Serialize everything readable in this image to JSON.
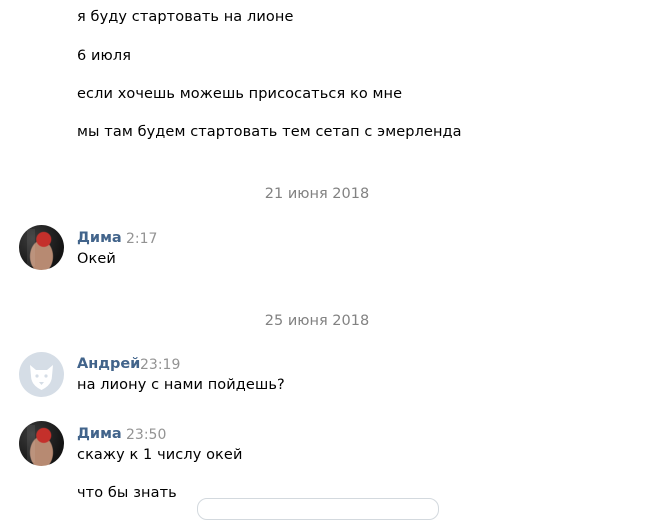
{
  "messages_top": [
    "я буду стартовать на лионе",
    "6 июля",
    "если хочешь можешь присосаться ко мне",
    "мы там будем стартовать тем сетап с эмерленда"
  ],
  "date_separators": [
    "21 июня 2018",
    "25 июня 2018"
  ],
  "message_groups": [
    {
      "author": "Дима",
      "time": "2:17",
      "avatar": "photo-avatar",
      "lines": [
        "Окей"
      ]
    },
    {
      "author": "Андрей",
      "time": "23:19",
      "avatar": "default-dog-avatar",
      "lines": [
        "на лиону с нами пойдешь?"
      ]
    },
    {
      "author": "Дима",
      "time": "23:50",
      "avatar": "photo-avatar",
      "lines": [
        "скажу к 1 числу окей",
        "что бы знать"
      ]
    }
  ],
  "colors": {
    "author": "#42648b",
    "time": "#939393",
    "date": "#828282",
    "text": "#000000"
  }
}
